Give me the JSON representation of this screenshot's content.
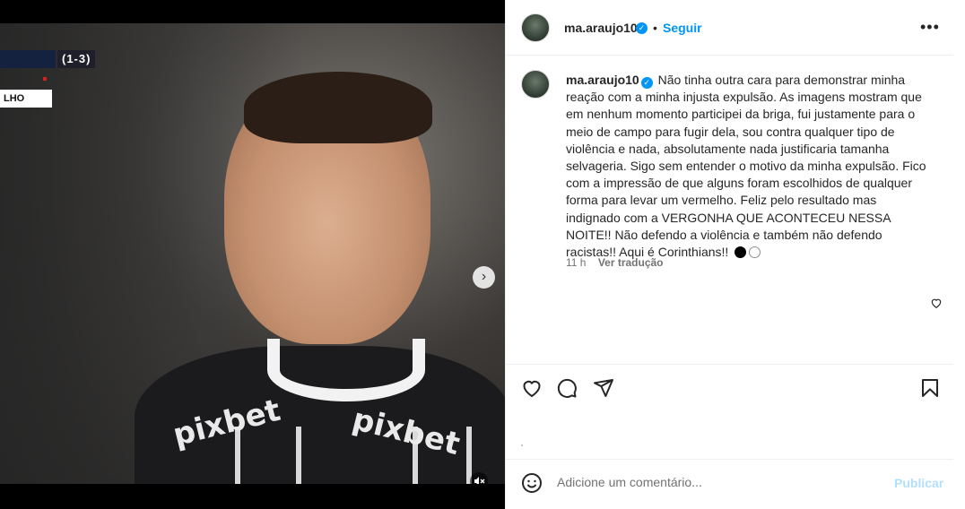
{
  "media": {
    "score_text": "(1-3)",
    "name_caption": "LHO",
    "jersey_text": "pixbet",
    "carousel": {
      "count": 2,
      "active_index": 0
    }
  },
  "header": {
    "username": "ma.araujo10",
    "separator": "•",
    "follow_label": "Seguir",
    "more_label": "•••"
  },
  "caption": {
    "username": "ma.araujo10",
    "text": "Não tinha outra cara para demonstrar minha reação com a minha injusta expulsão. As imagens mostram que em nenhum momento participei da briga, fui justamente para o meio de campo para fugir dela, sou contra qualquer tipo de violência e nada, absolutamente nada justificaria tamanha selvageria. Sigo sem entender o motivo da minha expulsão. Fico com a impressão de que alguns foram escolhidos de qualquer forma para levar um vermelho. Feliz pelo resultado mas indignado com a VERGONHA QUE ACONTECEU NESSA NOITE!! Não defendo a violência e também não defendo racistas!! Aqui é Corinthians!!",
    "emoji": [
      "black-circle",
      "white-circle"
    ]
  },
  "meta": {
    "time": "11 h",
    "translate_label": "Ver tradução"
  },
  "actions": [
    "heart-icon",
    "comment-icon",
    "share-icon",
    "bookmark-icon"
  ],
  "comment": {
    "placeholder": "Adicione um comentário...",
    "post_label": "Publicar"
  },
  "colors": {
    "accent": "#0095f6",
    "post_disabled": "#b2dffc",
    "text": "#262626",
    "muted": "#737373"
  }
}
